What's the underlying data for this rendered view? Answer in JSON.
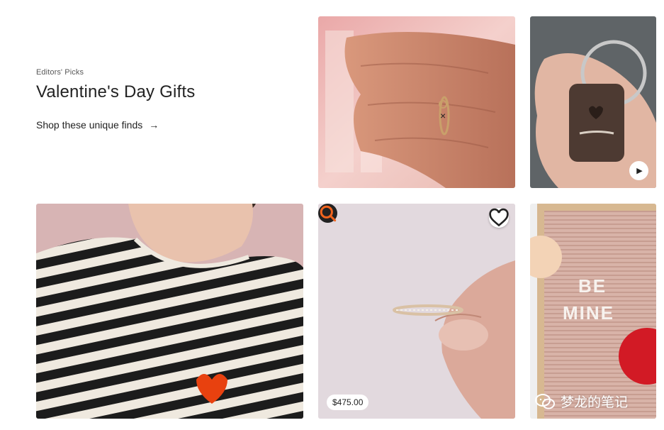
{
  "header": {
    "eyebrow": "Editors' Picks",
    "title": "Valentine's Day Gifts",
    "shop_link": "Shop these unique finds",
    "arrow": "→"
  },
  "tiles": {
    "band": {
      "price": "$475.00"
    },
    "board": {
      "letter_text_1": "BE",
      "letter_text_2": "MINE"
    }
  },
  "watermark": {
    "text": "梦龙的笔记"
  },
  "icons": {
    "shop_arrow": "arrow-right-icon",
    "play": "play-icon",
    "search": "search-icon",
    "favorite": "heart-outline-icon",
    "watermark": "wechat-icon"
  },
  "colors": {
    "accent": "#f1641e",
    "text": "#222222",
    "muted": "#595959"
  }
}
